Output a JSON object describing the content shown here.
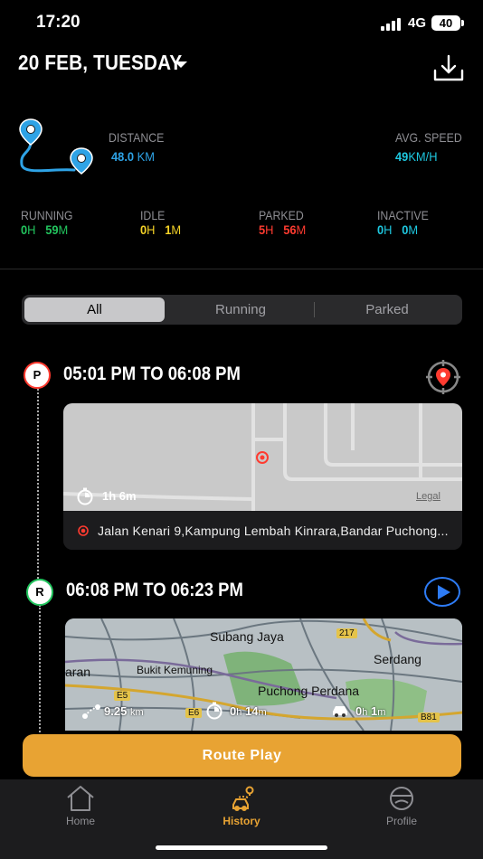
{
  "status_bar": {
    "time": "17:20",
    "network": "4G",
    "battery": "40"
  },
  "header": {
    "date_title": "20 FEB, TUESDAY"
  },
  "summary": {
    "distance": {
      "label": "DISTANCE",
      "value": "48.0",
      "unit": "KM"
    },
    "avg_speed": {
      "label": "AVG. SPEED",
      "value": "49",
      "unit": "KM/H"
    },
    "running": {
      "label": "RUNNING",
      "hours": "0",
      "h_unit": "H",
      "minutes": "59",
      "m_unit": "M"
    },
    "idle": {
      "label": "IDLE",
      "hours": "0",
      "h_unit": "H",
      "minutes": "1",
      "m_unit": "M"
    },
    "parked": {
      "label": "PARKED",
      "hours": "5",
      "h_unit": "H",
      "minutes": "56",
      "m_unit": "M"
    },
    "inactive": {
      "label": "INACTIVE",
      "hours": "0",
      "h_unit": "H",
      "minutes": "0",
      "m_unit": "M"
    }
  },
  "filter_tabs": [
    "All",
    "Running",
    "Parked"
  ],
  "trips": [
    {
      "badge": "P",
      "time_range": "05:01 PM TO 06:08 PM",
      "map_overlay_duration": "1h 6m",
      "map_legal": "Legal",
      "address": "Jalan Kenari 9,Kampung Lembah Kinrara,Bandar Puchong..."
    },
    {
      "badge": "R",
      "time_range": "06:08 PM TO 06:23 PM",
      "map_labels": [
        "Subang Jaya",
        "Bukit Kemuning",
        "Serdang",
        "Puchong Perdana",
        "aran",
        "E5",
        "E6",
        "217",
        "B81"
      ],
      "distance_value": "9.25",
      "distance_unit": "km",
      "duration_h": "0",
      "duration_m": "14",
      "idle_h": "0",
      "idle_m": "1",
      "h_unit": "h",
      "m_unit": "m"
    }
  ],
  "route_play_label": "Route Play",
  "tab_bar": [
    {
      "label": "Home",
      "icon": "home-icon"
    },
    {
      "label": "History",
      "icon": "history-icon"
    },
    {
      "label": "Profile",
      "icon": "profile-icon"
    }
  ],
  "colors": {
    "accent": "#e8a333",
    "blue": "#2ea3e6",
    "green": "#22c55e",
    "yellow": "#f5d327",
    "red": "#ff3b30",
    "cyan": "#1ec8e0"
  }
}
